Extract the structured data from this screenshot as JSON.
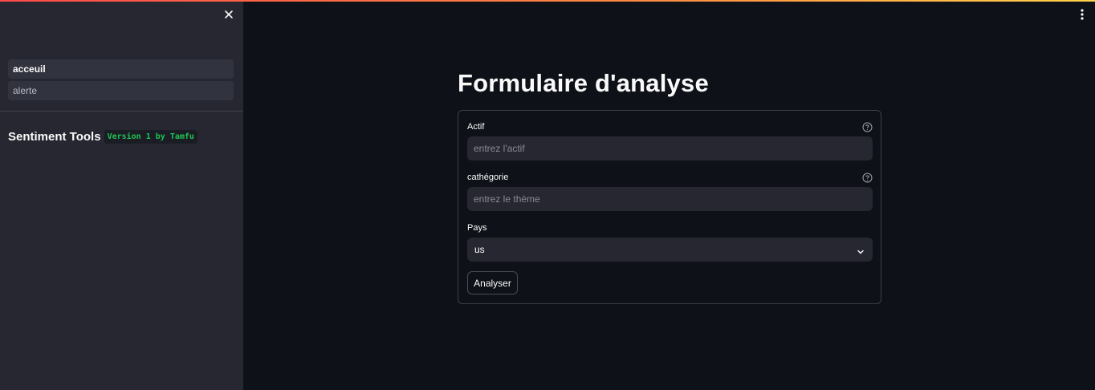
{
  "sidebar": {
    "close_icon": "close-icon",
    "nav": [
      {
        "label": "acceuil",
        "active": true
      },
      {
        "label": "alerte",
        "active": false
      }
    ],
    "title": "Sentiment Tools",
    "version_badge": "Version 1 by Tamfu"
  },
  "main": {
    "menu_icon": "vertical-ellipsis-icon",
    "title": "Formulaire d'analyse",
    "form": {
      "fields": [
        {
          "label": "Actif",
          "placeholder": "entrez l'actif",
          "value": "",
          "help_icon": "question-circle-icon"
        },
        {
          "label": "cathégorie",
          "placeholder": "entrez le thème",
          "value": "",
          "help_icon": "question-circle-icon"
        }
      ],
      "country": {
        "label": "Pays",
        "selected": "us",
        "icon": "chevron-down-icon"
      },
      "submit_label": "Analyser"
    }
  },
  "colors": {
    "background": "#0e1117",
    "sidebar": "#262730",
    "input": "#262730",
    "badge_text": "#21c354",
    "accent_gradient": [
      "#ff4b4b",
      "#ffd24b"
    ]
  }
}
